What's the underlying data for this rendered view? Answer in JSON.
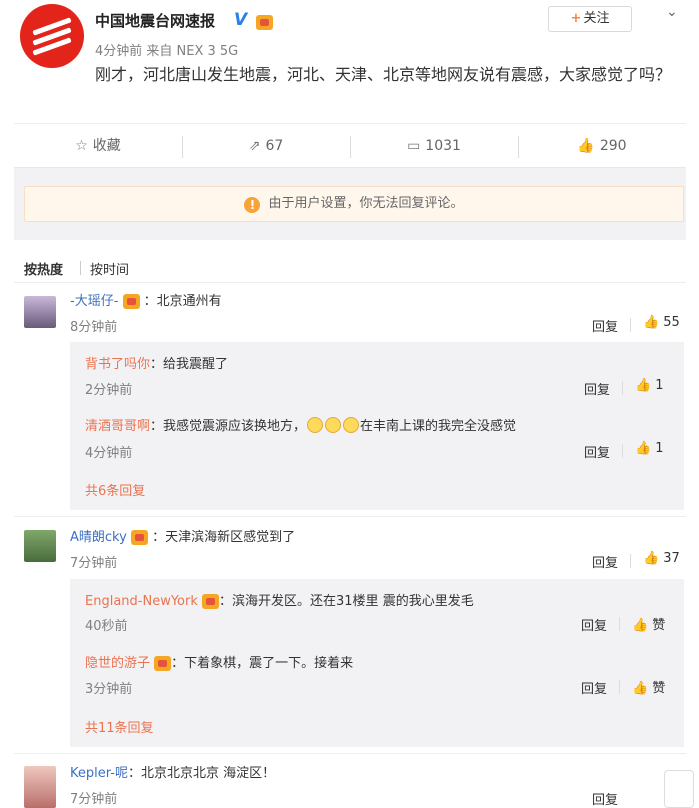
{
  "post": {
    "username": "中国地震台网速报",
    "verified": "V",
    "follow": {
      "plus": "+",
      "label": "关注"
    },
    "meta": "4分钟前 来自 NEX 3 5G",
    "text": "刚才，河北唐山发生地震，河北、天津、北京等地网友说有震感，大家感觉了吗？",
    "actions": {
      "favorite": "收藏",
      "repost": "67",
      "comment": "1031",
      "like": "290"
    }
  },
  "notice": "由于用户设置，你无法回复评论。",
  "sort": {
    "hot": "按热度",
    "time": "按时间"
  },
  "comments": [
    {
      "user": "-大瑶仔-",
      "text": "：北京通州有",
      "time": "8分钟前",
      "reply": "回复",
      "likes": "55",
      "replies": [
        {
          "user": "背书了吗你",
          "text": "：给我震醒了",
          "time": "2分钟前",
          "reply": "回复",
          "likes": "1"
        },
        {
          "user": "清酒哥哥啊",
          "text": "：我感觉震源应该换地方，",
          "text_after": "在丰南上课的我完全没感觉",
          "time": "4分钟前",
          "reply": "回复",
          "likes": "1"
        }
      ],
      "more": "共6条回复"
    },
    {
      "user": "A晴朗cky",
      "text": "：天津滨海新区感觉到了",
      "time": "7分钟前",
      "reply": "回复",
      "likes": "37",
      "replies": [
        {
          "user": "England-NewYork",
          "text": "：滨海开发区。还在31楼里 震的我心里发毛",
          "time": "40秒前",
          "reply": "回复",
          "likes": "赞"
        },
        {
          "user": "隐世的游子",
          "text": "：下着象棋，震了一下。接着来",
          "time": "3分钟前",
          "reply": "回复",
          "likes": "赞"
        }
      ],
      "more": "共11条回复"
    },
    {
      "user": "Kepler-呢",
      "text": "：北京北京北京 海淀区！",
      "time": "7分钟前",
      "reply": "回复"
    }
  ],
  "colors": {
    "accent": "#eb7350",
    "user_link": "#3b6fc2",
    "panel": "#f2f2f5",
    "logo": "#e2241a"
  },
  "icons": [
    "star-icon",
    "repost-icon",
    "comment-icon",
    "thumbs-up-icon",
    "info-icon",
    "member-crown-icon",
    "chevron-down-icon"
  ]
}
